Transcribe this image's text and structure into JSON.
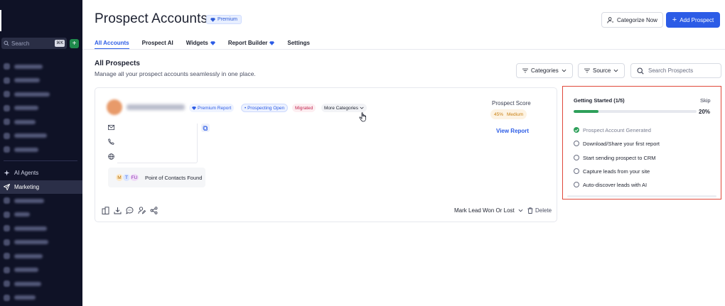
{
  "sidebar": {
    "search_placeholder": "Search",
    "search_shortcut": "⌘K",
    "add_label": "+",
    "section_items": [
      {
        "label": "AI Agents",
        "icon": "sparkle-icon"
      },
      {
        "label": "Marketing",
        "icon": "send-icon",
        "active": true
      }
    ]
  },
  "header": {
    "title": "Prospect Accounts",
    "premium_badge": "Premium",
    "categorize_button": "Categorize Now",
    "add_button": "Add Prospect"
  },
  "tabs": [
    {
      "label": "All Accounts",
      "active": true,
      "premium": false
    },
    {
      "label": "Prospect AI",
      "active": false,
      "premium": false
    },
    {
      "label": "Widgets",
      "active": false,
      "premium": true
    },
    {
      "label": "Report Builder",
      "active": false,
      "premium": true
    },
    {
      "label": "Settings",
      "active": false,
      "premium": false
    }
  ],
  "section": {
    "title": "All Prospects",
    "subtitle": "Manage all your prospect accounts seamlessly in one place."
  },
  "filters": {
    "categories_label": "Categories",
    "source_label": "Source",
    "search_placeholder": "Search Prospects"
  },
  "prospect_card": {
    "tags": {
      "premium_report": "Premium Report",
      "prospecting": "• Prospecting Open",
      "migrated": "Migrated",
      "more_categories": "More Categories"
    },
    "score_label": "Prospect Score",
    "score_value": "45%",
    "score_level": "Medium",
    "view_report": "View Report",
    "contacts": {
      "avatars": [
        {
          "initials": "M",
          "bg": "#fde9c8",
          "fg": "#b46a00"
        },
        {
          "initials": "T",
          "bg": "#dbe6ff",
          "fg": "#2c5ce6"
        },
        {
          "initials": "FU",
          "bg": "#f0dcf7",
          "fg": "#8a2fb1"
        }
      ],
      "label": "Point of Contacts Found"
    },
    "lead_status": "Mark Lead Won Or Lost",
    "delete_label": "Delete"
  },
  "getting_started": {
    "title": "Getting Started (1/5)",
    "skip": "Skip",
    "progress_percent": 20,
    "progress_label": "20%",
    "steps": [
      {
        "label": "Prospect Account Generated",
        "done": true
      },
      {
        "label": "Download/Share your first report",
        "done": false
      },
      {
        "label": "Start sending prospect to CRM",
        "done": false
      },
      {
        "label": "Capture leads from your site",
        "done": false
      },
      {
        "label": "Auto-discover leads with AI",
        "done": false
      }
    ]
  },
  "colors": {
    "accent": "#2c5ce6",
    "sidebar_bg": "#0f1226",
    "success": "#2ea05a",
    "highlight_border": "#e0483a"
  }
}
